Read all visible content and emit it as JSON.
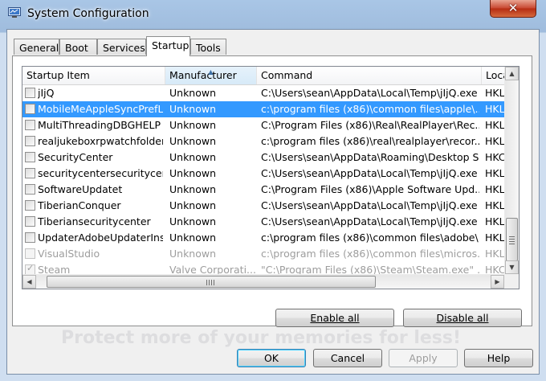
{
  "window": {
    "title": "System Configuration",
    "close_glyph": "✕",
    "icon": "msconfig-icon"
  },
  "tabs": [
    {
      "label": "General"
    },
    {
      "label": "Boot"
    },
    {
      "label": "Services"
    },
    {
      "label": "Startup",
      "active": true
    },
    {
      "label": "Tools"
    }
  ],
  "listview": {
    "columns": [
      "Startup Item",
      "Manufacturer",
      "Command",
      "Loca"
    ],
    "sorted_column": "Manufacturer",
    "rows": [
      {
        "item": "jIjQ",
        "manufacturer": "Unknown",
        "command": "C:\\Users\\sean\\AppData\\Local\\Temp\\jIjQ.exe",
        "location": "HKL",
        "checked": false,
        "selected": false,
        "disabled": false
      },
      {
        "item": "MobileMeAppleSyncPrefL...",
        "manufacturer": "Unknown",
        "command": "c:\\program files (x86)\\common files\\apple\\...",
        "location": "HKL",
        "checked": false,
        "selected": true,
        "disabled": false
      },
      {
        "item": "MultiThreadingDBGHELP",
        "manufacturer": "Unknown",
        "command": "C:\\Program Files (x86)\\Real\\RealPlayer\\Rec...",
        "location": "HKL",
        "checked": false,
        "selected": false,
        "disabled": false
      },
      {
        "item": "realjukeboxrpwatchfolders",
        "manufacturer": "Unknown",
        "command": "c:\\program files (x86)\\real\\realplayer\\recor...",
        "location": "HKL",
        "checked": false,
        "selected": false,
        "disabled": false
      },
      {
        "item": "SecurityCenter",
        "manufacturer": "Unknown",
        "command": "C:\\Users\\sean\\AppData\\Roaming\\Desktop S...",
        "location": "HKC",
        "checked": false,
        "selected": false,
        "disabled": false
      },
      {
        "item": "securitycentersecuritycen...",
        "manufacturer": "Unknown",
        "command": "C:\\Users\\sean\\AppData\\Local\\Temp\\jIjQ.exe",
        "location": "HKL",
        "checked": false,
        "selected": false,
        "disabled": false
      },
      {
        "item": "SoftwareUpdatet",
        "manufacturer": "Unknown",
        "command": "C:\\Program Files (x86)\\Apple Software Upd...",
        "location": "HKL",
        "checked": false,
        "selected": false,
        "disabled": false
      },
      {
        "item": "TiberianConquer",
        "manufacturer": "Unknown",
        "command": "C:\\Users\\sean\\AppData\\Local\\Temp\\jIjQ.exe",
        "location": "HKL",
        "checked": false,
        "selected": false,
        "disabled": false
      },
      {
        "item": "Tiberiansecuritycenter",
        "manufacturer": "Unknown",
        "command": "C:\\Users\\sean\\AppData\\Local\\Temp\\jIjQ.exe",
        "location": "HKL",
        "checked": false,
        "selected": false,
        "disabled": false
      },
      {
        "item": "UpdaterAdobeUpdaterIns...",
        "manufacturer": "Unknown",
        "command": "c:\\program files (x86)\\common files\\adobe\\...",
        "location": "HKL",
        "checked": false,
        "selected": false,
        "disabled": false
      },
      {
        "item": "VisualStudio",
        "manufacturer": "Unknown",
        "command": "c:\\program files (x86)\\common files\\micros...",
        "location": "HKL",
        "checked": false,
        "selected": false,
        "disabled": true
      },
      {
        "item": "Steam",
        "manufacturer": "Valve Corporati...",
        "command": "\"C:\\Program Files (x86)\\Steam\\Steam.exe\" ...",
        "location": "HKC",
        "checked": true,
        "selected": false,
        "disabled": true
      }
    ],
    "scroll_up_glyph": "▲",
    "scroll_down_glyph": "▼",
    "scroll_left_glyph": "◀",
    "scroll_right_glyph": "▶",
    "check_glyph": "✓",
    "sort_glyph": "▲"
  },
  "watermark": "Protect more of your memories for less!",
  "panel_buttons": {
    "enable_all": "Enable all",
    "disable_all": "Disable all"
  },
  "dialog_buttons": {
    "ok": "OK",
    "cancel": "Cancel",
    "apply": "Apply",
    "help": "Help"
  }
}
